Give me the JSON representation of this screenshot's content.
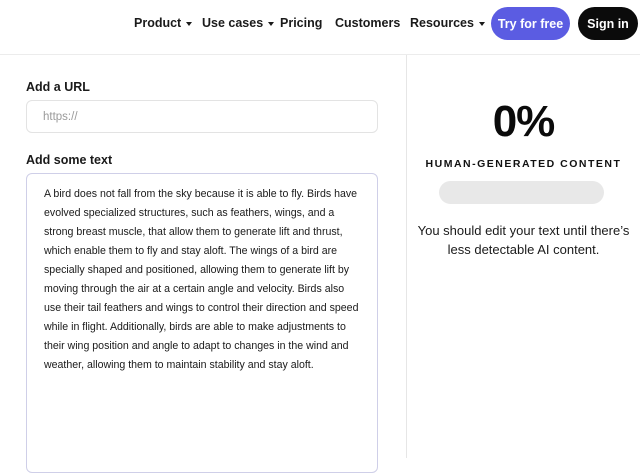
{
  "nav": {
    "product": "Product",
    "use_cases": "Use cases",
    "pricing": "Pricing",
    "customers": "Customers",
    "resources": "Resources",
    "try_free": "Try for free",
    "sign_in": "Sign in"
  },
  "form": {
    "url_label": "Add a URL",
    "url_placeholder": "https://",
    "text_label": "Add some text",
    "text_value": "A bird does not fall from the sky because it is able to fly. Birds have evolved specialized structures, such as feathers, wings, and a strong breast muscle, that allow them to generate lift and thrust, which enable them to fly and stay aloft. The wings of a bird are specially shaped and positioned, allowing them to generate lift by moving through the air at a certain angle and velocity. Birds also use their tail feathers and wings to control their direction and speed while in flight. Additionally, birds are able to make adjustments to their wing position and angle to adapt to changes in the wind and weather, allowing them to maintain stability and stay aloft."
  },
  "result": {
    "score": "0%",
    "caption": "HUMAN-GENERATED CONTENT",
    "progress_fraction": 0,
    "advice": "You should edit your text until there’s less detectable AI content."
  },
  "colors": {
    "accent": "#5b5ce2",
    "dark_button": "#0b0b0b",
    "progress_track": "#e8e8e8"
  }
}
